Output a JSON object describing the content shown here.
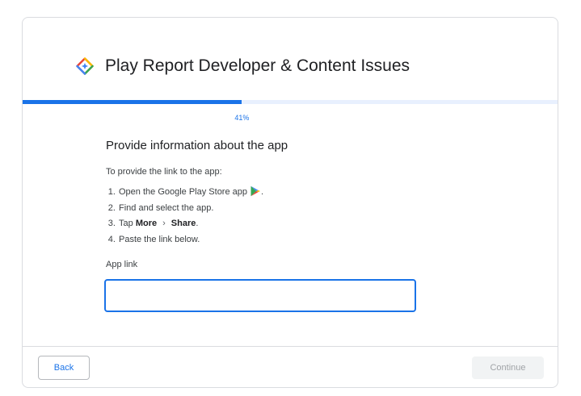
{
  "header": {
    "title": "Play Report Developer & Content Issues",
    "logo_icon": "google-diamond-logo-icon"
  },
  "progress": {
    "value_percent": 41,
    "label": "41%",
    "fill_color": "#1a73e8",
    "track_color": "#e8f0fe"
  },
  "main": {
    "heading": "Provide information about the app",
    "intro": "To provide the link to the app:",
    "steps": {
      "s1": {
        "text": "Open the Google Play Store app",
        "icon": "google-play-icon",
        "suffix": "."
      },
      "s2": {
        "text": "Find and select the app."
      },
      "s3": {
        "prefix": "Tap",
        "more": "More",
        "chevron": "›",
        "share": "Share",
        "suffix": "."
      },
      "s4": {
        "text": "Paste the link below."
      }
    },
    "field": {
      "label": "App link",
      "value": "",
      "placeholder": ""
    }
  },
  "footer": {
    "back_label": "Back",
    "continue_label": "Continue"
  },
  "colors": {
    "accent": "#1a73e8",
    "disabled_bg": "#f1f3f4",
    "disabled_text": "#a0a3a7"
  }
}
